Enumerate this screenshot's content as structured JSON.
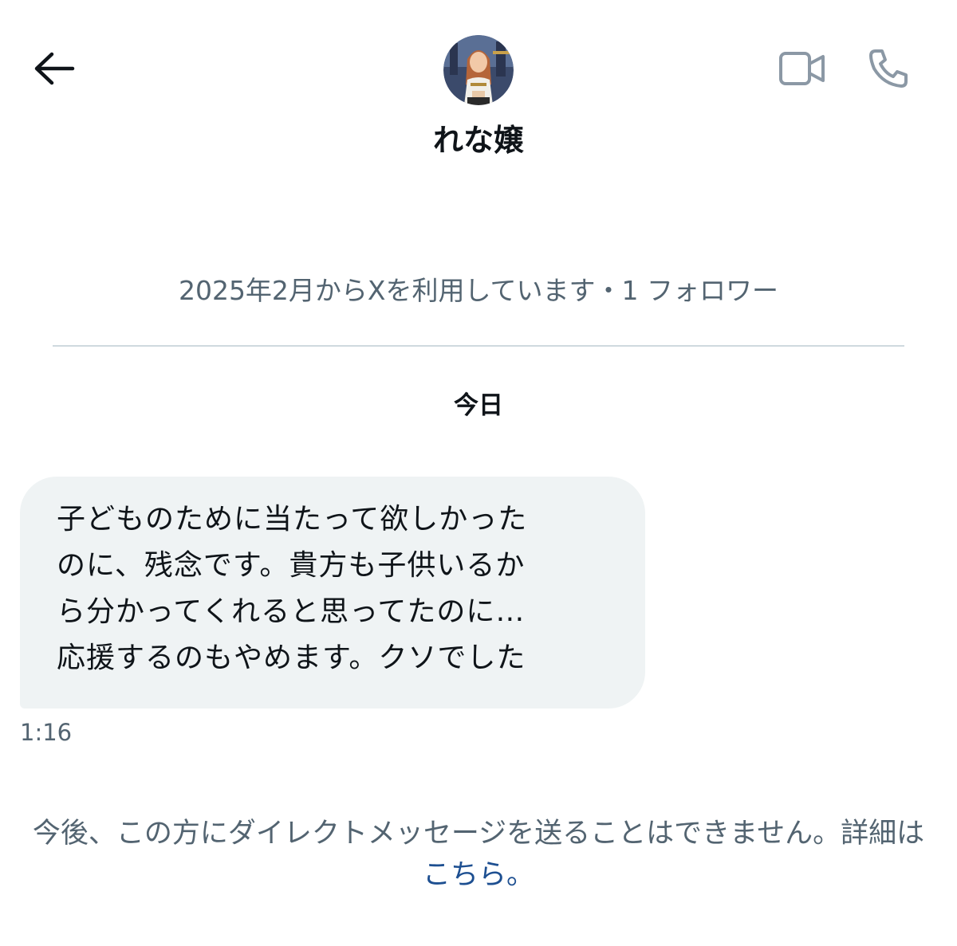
{
  "header": {
    "display_name": "れな嬢"
  },
  "profile": {
    "meta": "2025年2月からXを利用しています・1 フォロワー"
  },
  "conversation": {
    "date_separator": "今日",
    "messages": [
      {
        "text": "子どものために当たって欲しかった\nのに、残念です。貴方も子供いるか\nら分かってくれると思ってたのに…\n応援するのもやめます。クソでした",
        "time": "1:16"
      }
    ]
  },
  "notice": {
    "text": "今後、この方にダイレクトメッセージを送ることはできません。詳細は",
    "link_label": "こちら",
    "suffix": "。"
  },
  "icons": {
    "back": "arrow-left-icon",
    "video": "video-camera-icon",
    "phone": "phone-icon"
  },
  "colors": {
    "primary_text": "#0f1419",
    "secondary_text": "#536471",
    "bubble_bg": "#eff3f4",
    "link": "#1d4f91",
    "icon_gray": "#8b98a5"
  }
}
